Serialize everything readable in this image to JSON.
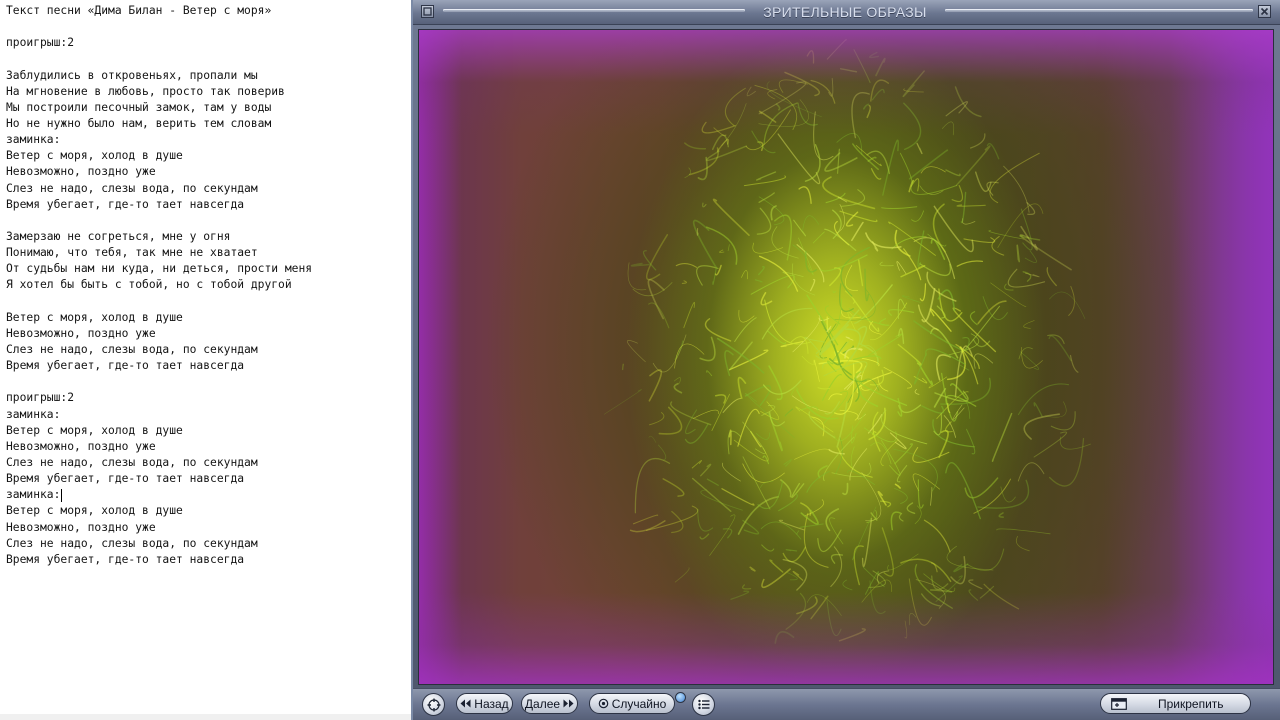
{
  "editor": {
    "lines": [
      "Текст песни «Дима Билан - Ветер с моря»",
      "",
      "проигрыш:2",
      "",
      "Заблудились в откровеньях, пропали мы",
      "На мгновение в любовь, просто так поверив",
      "Мы построили песочный замок, там у воды",
      "Но не нужно было нам, верить тем словам",
      "заминка:",
      "Ветер с моря, холод в душе",
      "Невозможно, поздно уже",
      "Слез не надо, слезы вода, по секундам",
      "Время убегает, где-то тает навсегда",
      "",
      "Замерзаю не согреться, мне у огня",
      "Понимаю, что тебя, так мне не хватает",
      "От судьбы нам ни куда, ни деться, прости меня",
      "Я хотел бы быть с тобой, но с тобой другой",
      "",
      "Ветер с моря, холод в душе",
      "Невозможно, поздно уже",
      "Слез не надо, слезы вода, по секундам",
      "Время убегает, где-то тает навсегда",
      "",
      "проигрыш:2",
      "заминка:",
      "Ветер с моря, холод в душе",
      "Невозможно, поздно уже",
      "Слез не надо, слезы вода, по секундам",
      "Время убегает, где-то тает навсегда",
      "заминка:",
      "Ветер с моря, холод в душе",
      "Невозможно, поздно уже",
      "Слез не надо, слезы вода, по секундам",
      "Время убегает, где-то тает навсегда"
    ],
    "caret_line": 30
  },
  "player": {
    "title": "ЗРИТЕЛЬНЫЕ ОБРАЗЫ",
    "controls": {
      "back_label": "Назад",
      "next_label": "Далее",
      "random_label": "Случайно",
      "attach_label": "Прикрепить"
    },
    "icons": {
      "menu": "window-menu-icon",
      "close": "close-icon",
      "nav": "navigation-cross-icon",
      "list": "list-icon",
      "attach": "attach-window-icon"
    },
    "colors": {
      "chrome": "#6b7690",
      "viz_edge": "#8a3fb0",
      "viz_center": "#d8e628"
    }
  }
}
